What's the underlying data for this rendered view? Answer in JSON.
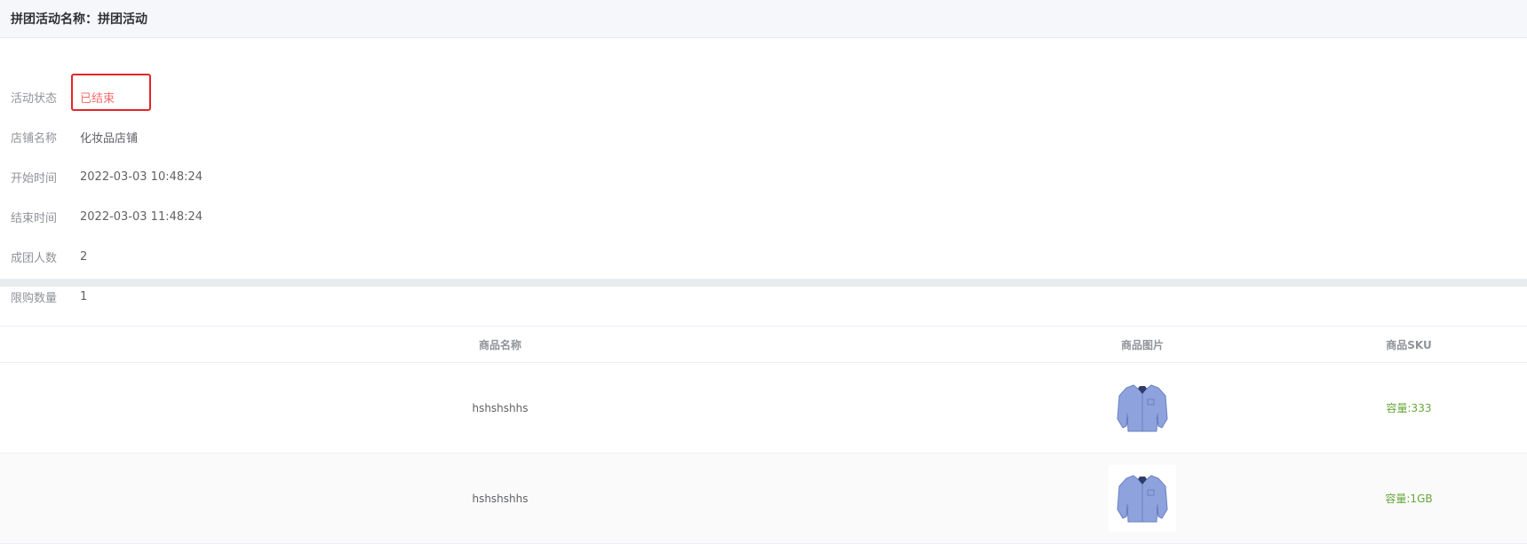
{
  "header": {
    "title": "拼团活动名称：拼团活动"
  },
  "info": {
    "rows": [
      {
        "label": "活动状态",
        "value": "已结束"
      },
      {
        "label": "店铺名称",
        "value": "化妆品店铺"
      },
      {
        "label": "开始时间",
        "value": "2022-03-03 10:48:24"
      },
      {
        "label": "结束时间",
        "value": "2022-03-03 11:48:24"
      },
      {
        "label": "成团人数",
        "value": "2"
      },
      {
        "label": "限购数量",
        "value": "1"
      }
    ]
  },
  "table": {
    "columns": [
      "商品名称",
      "商品图片",
      "商品SKU"
    ],
    "rows": [
      {
        "name": "hshshshhs",
        "image": "shirt-icon",
        "sku": "容量:333"
      },
      {
        "name": "hshshshhs",
        "image": "shirt-icon",
        "sku": "容量:1GB"
      }
    ]
  },
  "colors": {
    "status": "#f56c6c",
    "sku": "#67a63a",
    "highlight_box": "#e5242b"
  }
}
